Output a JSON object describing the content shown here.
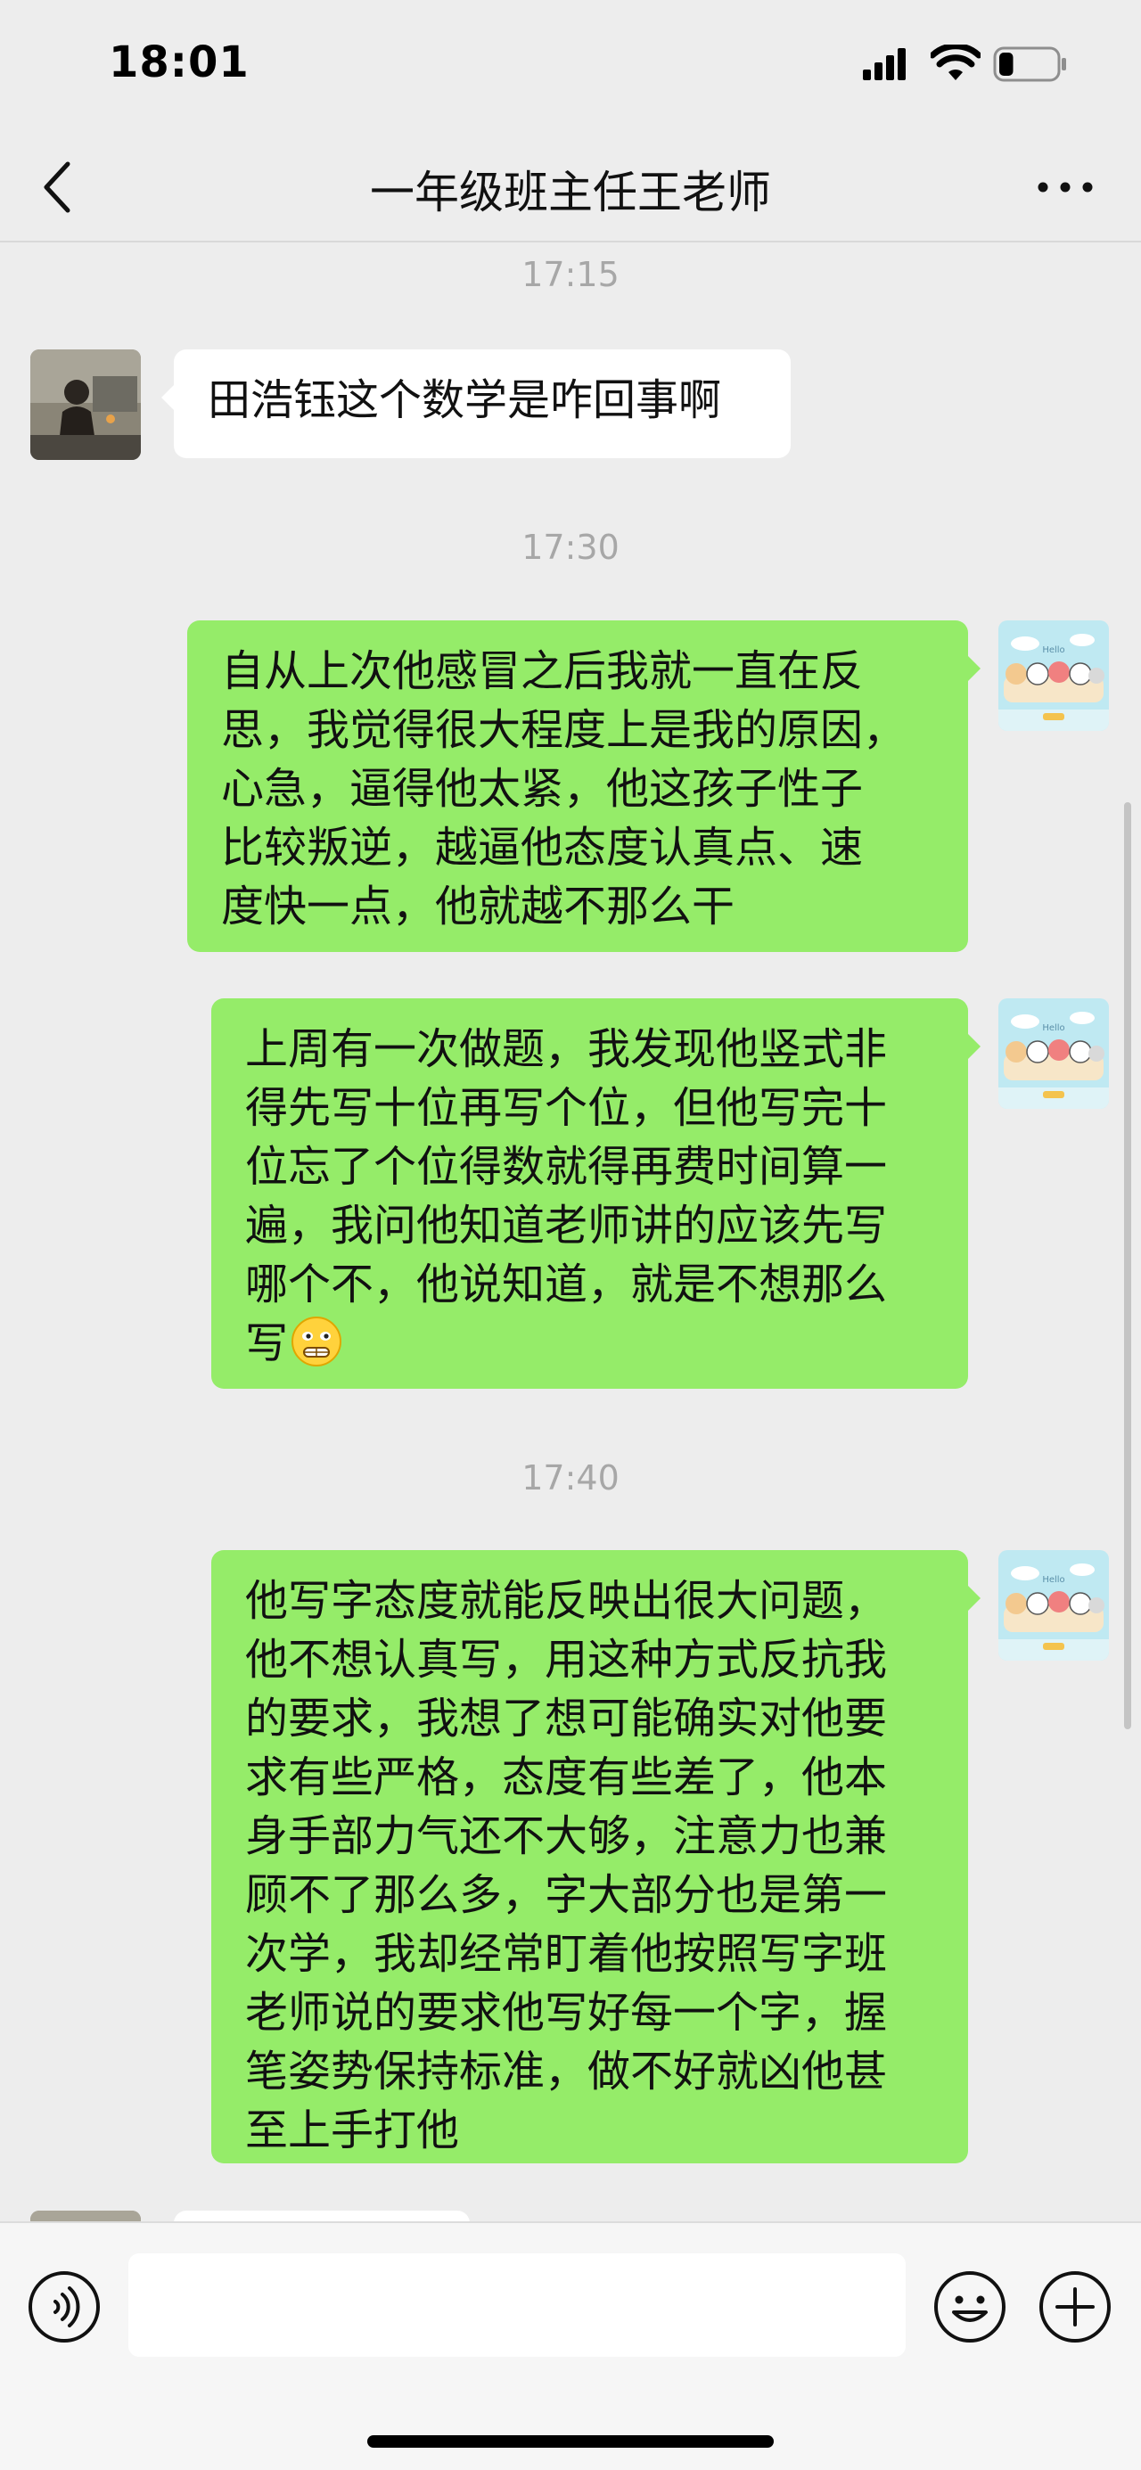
{
  "status_bar": {
    "time": "18:01",
    "battery_level": 0.25
  },
  "header": {
    "title": "一年级班主任王老师"
  },
  "messages": [
    {
      "kind": "timestamp",
      "text": "17:15"
    },
    {
      "kind": "incoming",
      "lines": [
        "田浩钰这个数学是咋回事啊"
      ]
    },
    {
      "kind": "timestamp",
      "text": "17:30"
    },
    {
      "kind": "outgoing",
      "lines": [
        "自从上次他感冒之后我就一直在反",
        "思，我觉得很大程度上是我的原因，",
        "心急，逼得他太紧，他这孩子性子",
        "比较叛逆，越逼他态度认真点、速",
        "度快一点，他就越不那么干"
      ]
    },
    {
      "kind": "outgoing",
      "lines": [
        "上周有一次做题，我发现他竖式非",
        "得先写十位再写个位，但他写完十",
        "位忘了个位得数就得再费时间算一",
        "遍，我问他知道老师讲的应该先写",
        "哪个不，他说知道，就是不想那么",
        "写"
      ],
      "trailing_emoji": "grimace-emoji"
    },
    {
      "kind": "timestamp",
      "text": "17:40"
    },
    {
      "kind": "outgoing",
      "lines": [
        "他写字态度就能反映出很大问题，",
        "他不想认真写，用这种方式反抗我",
        "的要求，我想了想可能确实对他要",
        "求有些严格，态度有些差了，他本",
        "身手部力气还不大够，注意力也兼",
        "顾不了那么多，字大部分也是第一",
        "次学，我却经常盯着他按照写字班",
        "老师说的要求他写好每一个字，握",
        "笔姿势保持标准，做不好就凶他甚",
        "至上手打他"
      ]
    }
  ],
  "input": {
    "value": ""
  },
  "colors": {
    "outgoing_bubble": "#95ec69",
    "incoming_bubble": "#ffffff",
    "background": "#ededed"
  }
}
